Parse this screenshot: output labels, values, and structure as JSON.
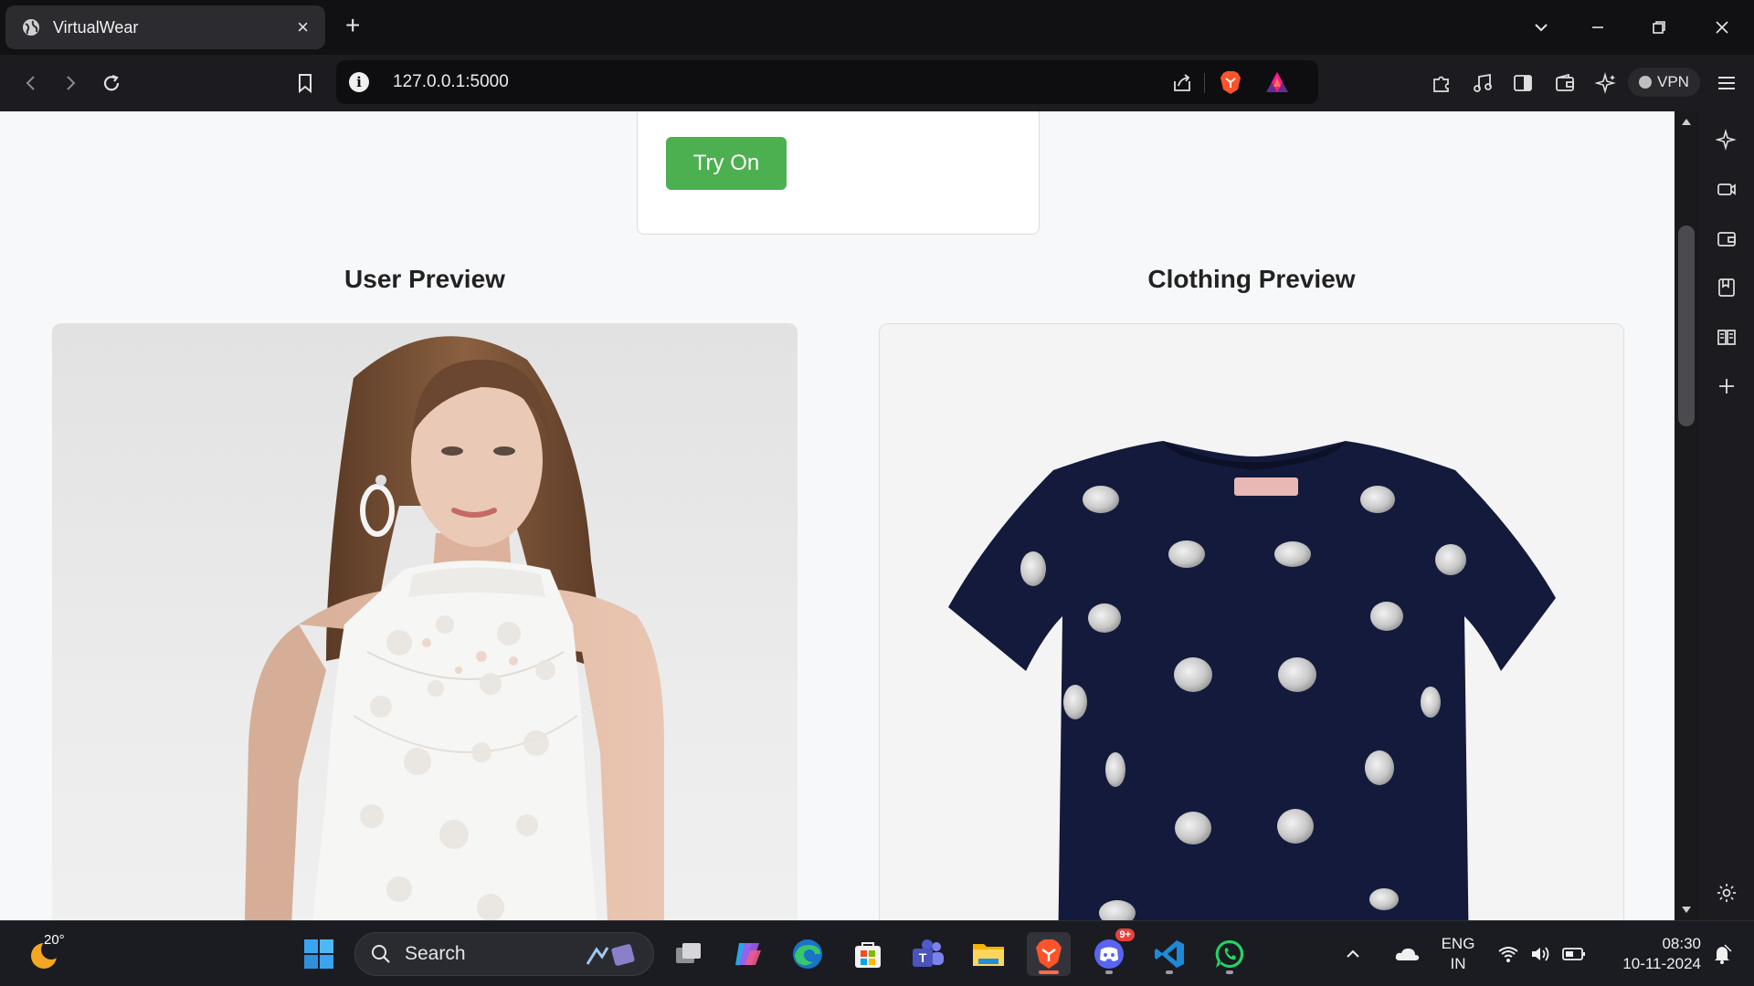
{
  "browser": {
    "tab_title": "VirtualWear",
    "tab_close": "×",
    "new_tab": "+",
    "url": "127.0.0.1:5000",
    "vpn_label": "VPN"
  },
  "page": {
    "try_on_label": "Try On",
    "user_preview_title": "User Preview",
    "clothing_preview_title": "Clothing Preview",
    "accent_color": "#4caf50"
  },
  "taskbar": {
    "temperature": "20°",
    "search_placeholder": "Search",
    "discord_badge": "9+",
    "lang_line1": "ENG",
    "lang_line2": "IN",
    "time": "08:30",
    "date": "10-11-2024"
  }
}
